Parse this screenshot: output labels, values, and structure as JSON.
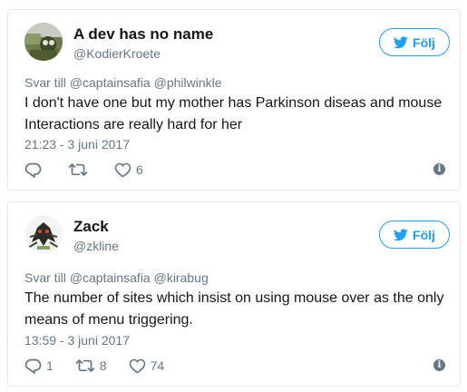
{
  "tweets": [
    {
      "display_name": "A dev has no name",
      "handle": "@KodierKroete",
      "follow_label": "Följ",
      "reply_to": "Svar till @captainsafia @philwinkle",
      "text": "I don't have one but my mother has Parkinson diseas and mouse Interactions are really hard for her",
      "timestamp": "21:23 - 3 juni 2017",
      "replies": "",
      "retweets": "",
      "likes": "6"
    },
    {
      "display_name": "Zack",
      "handle": "@zkline",
      "follow_label": "Följ",
      "reply_to": "Svar till @captainsafia @kirabug",
      "text": "The number of sites which insist on using mouse over as the only means of menu triggering.",
      "timestamp": "13:59 - 3 juni 2017",
      "replies": "1",
      "retweets": "8",
      "likes": "74"
    }
  ],
  "colors": {
    "accent": "#1da1f2",
    "muted": "#657786",
    "text": "#14171a",
    "border": "#e1e8ed"
  },
  "icons": [
    "twitter-bird-icon",
    "reply-icon",
    "retweet-icon",
    "heart-icon",
    "info-icon"
  ]
}
